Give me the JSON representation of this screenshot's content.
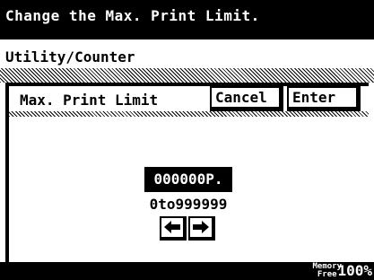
{
  "header": {
    "title": "Change the Max. Print Limit."
  },
  "breadcrumb": {
    "text": "Utility/Counter"
  },
  "panel": {
    "title": "Max. Print Limit",
    "cancel_label": "Cancel",
    "enter_label": "Enter"
  },
  "value": {
    "current": "000000P.",
    "range": "0to999999"
  },
  "arrows": {
    "left_icon": "left-arrow-icon",
    "right_icon": "right-arrow-icon"
  },
  "status": {
    "memory_label_line1": "Memory",
    "memory_label_line2": "Free",
    "memory_value": "100%"
  }
}
